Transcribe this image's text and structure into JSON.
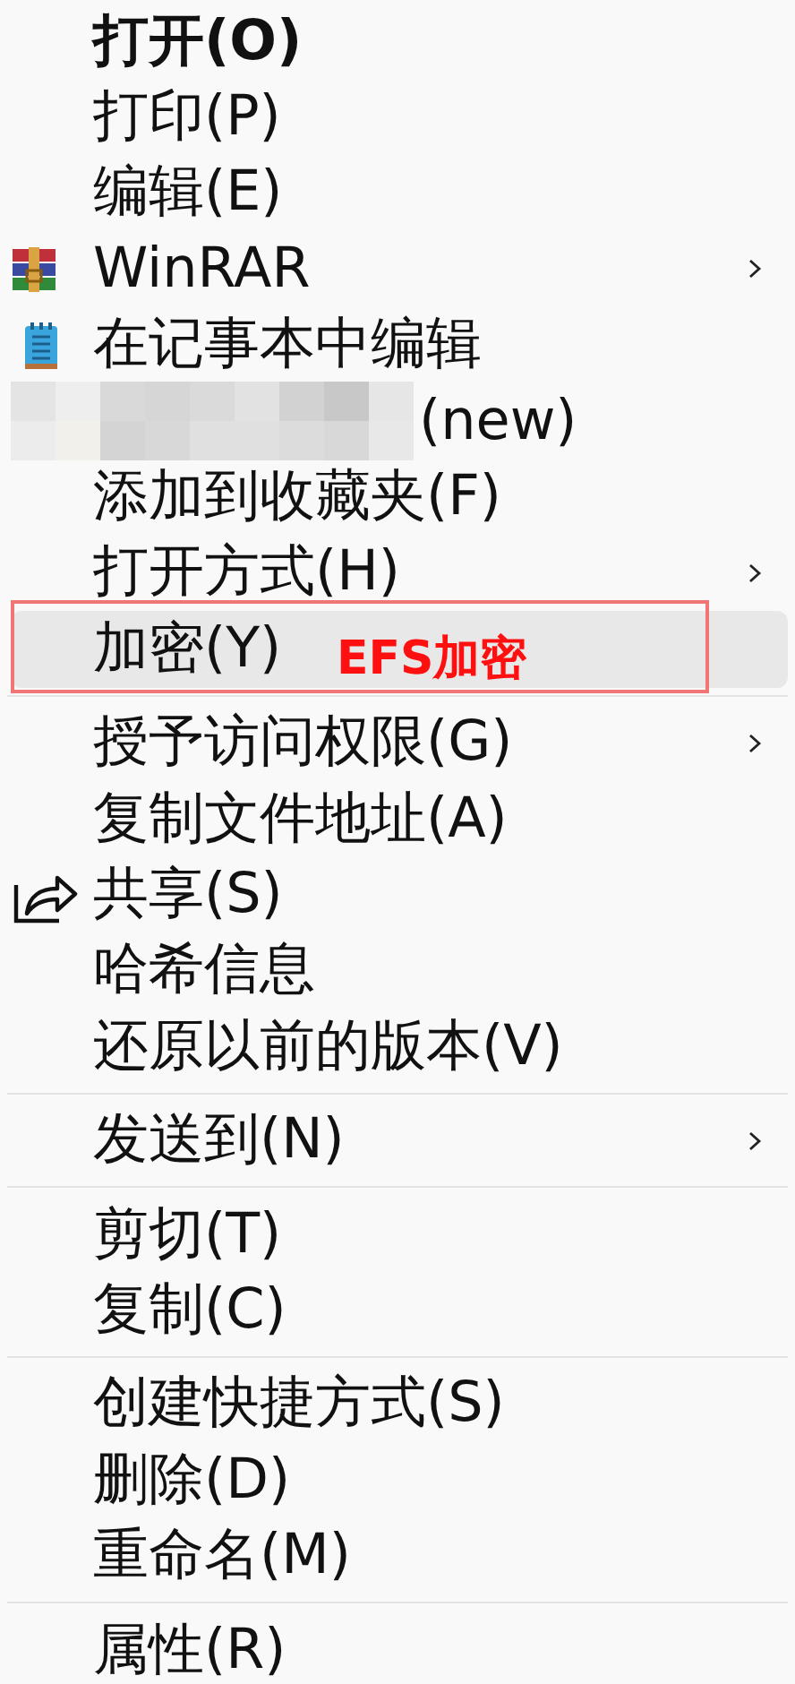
{
  "sections": [
    {
      "items": [
        {
          "label": "打开(O)",
          "kind": "plain",
          "default": true,
          "submenu": false,
          "highlighted": false
        },
        {
          "label": "打印(P)",
          "kind": "plain",
          "default": false,
          "submenu": false,
          "highlighted": false
        },
        {
          "label": "编辑(E)",
          "kind": "plain",
          "default": false,
          "submenu": false,
          "highlighted": false
        },
        {
          "label": "WinRAR",
          "kind": "archive",
          "default": false,
          "submenu": true,
          "highlighted": false
        },
        {
          "label": "在记事本中编辑",
          "kind": "notepad",
          "default": false,
          "submenu": false,
          "highlighted": false
        },
        {
          "label": "(new)",
          "kind": "redacted",
          "default": false,
          "submenu": false,
          "highlighted": false
        },
        {
          "label": "添加到收藏夹(F)",
          "kind": "plain",
          "default": false,
          "submenu": false,
          "highlighted": false
        },
        {
          "label": "打开方式(H)",
          "kind": "plain",
          "default": false,
          "submenu": true,
          "highlighted": false
        },
        {
          "label": "加密(Y)",
          "kind": "plain",
          "default": false,
          "submenu": false,
          "highlighted": true,
          "callout": "EFS加密"
        }
      ]
    },
    {
      "items": [
        {
          "label": "授予访问权限(G)",
          "kind": "plain",
          "default": false,
          "submenu": true,
          "highlighted": false
        },
        {
          "label": "复制文件地址(A)",
          "kind": "plain",
          "default": false,
          "submenu": false,
          "highlighted": false
        },
        {
          "label": "共享(S)",
          "kind": "share",
          "default": false,
          "submenu": false,
          "highlighted": false
        },
        {
          "label": "哈希信息",
          "kind": "plain",
          "default": false,
          "submenu": false,
          "highlighted": false
        },
        {
          "label": "还原以前的版本(V)",
          "kind": "plain",
          "default": false,
          "submenu": false,
          "highlighted": false
        }
      ]
    },
    {
      "items": [
        {
          "label": "发送到(N)",
          "kind": "plain",
          "default": false,
          "submenu": true,
          "highlighted": false
        }
      ]
    },
    {
      "items": [
        {
          "label": "剪切(T)",
          "kind": "plain",
          "default": false,
          "submenu": false,
          "highlighted": false
        },
        {
          "label": "复制(C)",
          "kind": "plain",
          "default": false,
          "submenu": false,
          "highlighted": false
        }
      ]
    },
    {
      "items": [
        {
          "label": "创建快捷方式(S)",
          "kind": "plain",
          "default": false,
          "submenu": false,
          "highlighted": false
        },
        {
          "label": "删除(D)",
          "kind": "plain",
          "default": false,
          "submenu": false,
          "highlighted": false
        },
        {
          "label": "重命名(M)",
          "kind": "plain",
          "default": false,
          "submenu": false,
          "highlighted": false
        }
      ]
    },
    {
      "items": [
        {
          "label": "属性(R)",
          "kind": "plain",
          "default": false,
          "submenu": false,
          "highlighted": false
        }
      ]
    }
  ]
}
